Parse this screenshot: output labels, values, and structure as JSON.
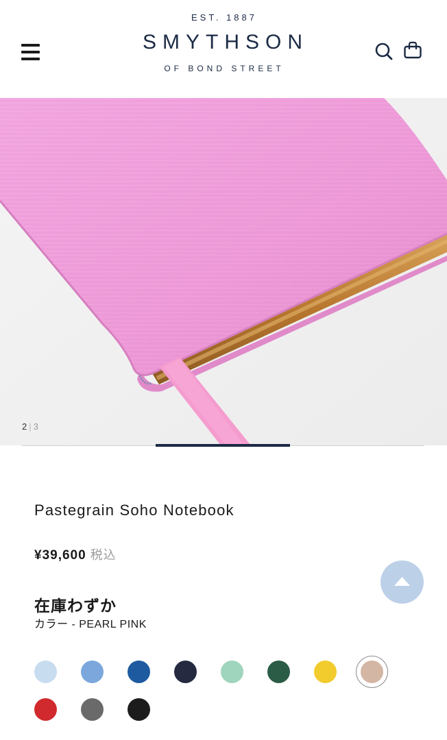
{
  "header": {
    "est": "EST. 1887",
    "brand": "SMYTHSON",
    "subtitle": "OF BOND STREET",
    "icons": [
      "menu-icon",
      "search-icon",
      "shopping-bag-icon"
    ]
  },
  "gallery": {
    "current": "2",
    "separator": "|",
    "total": "3",
    "progress_start": 0.333,
    "progress_end": 0.667
  },
  "product": {
    "title": "Pastegrain Soho Notebook",
    "price": "¥39,600",
    "tax_label": "税込",
    "stock": "在庫わずか",
    "color_label": "カラー - PEARL PINK"
  },
  "back_to_top": {
    "icon": "arrow-up-icon"
  },
  "swatches": [
    {
      "color": "#c8dcf0",
      "name": "light-blue"
    },
    {
      "color": "#7ba7dc",
      "name": "sky-blue"
    },
    {
      "color": "#1e5aa0",
      "name": "cobalt"
    },
    {
      "color": "#252a40",
      "name": "navy"
    },
    {
      "color": "#9fd4bd",
      "name": "mint"
    },
    {
      "color": "#2a5c46",
      "name": "forest-green"
    },
    {
      "color": "#f2cb2c",
      "name": "yellow"
    },
    {
      "color": "#d4b6a5",
      "name": "nude",
      "selected": true
    },
    {
      "color": "#d02a2e",
      "name": "red"
    },
    {
      "color": "#6a6a6a",
      "name": "grey"
    },
    {
      "color": "#1c1c1c",
      "name": "black"
    }
  ],
  "colors": {
    "brand_navy": "#1b2a44",
    "notebook_pink": "#ee9ad8",
    "back_to_top_bg": "#bcd0e8"
  }
}
